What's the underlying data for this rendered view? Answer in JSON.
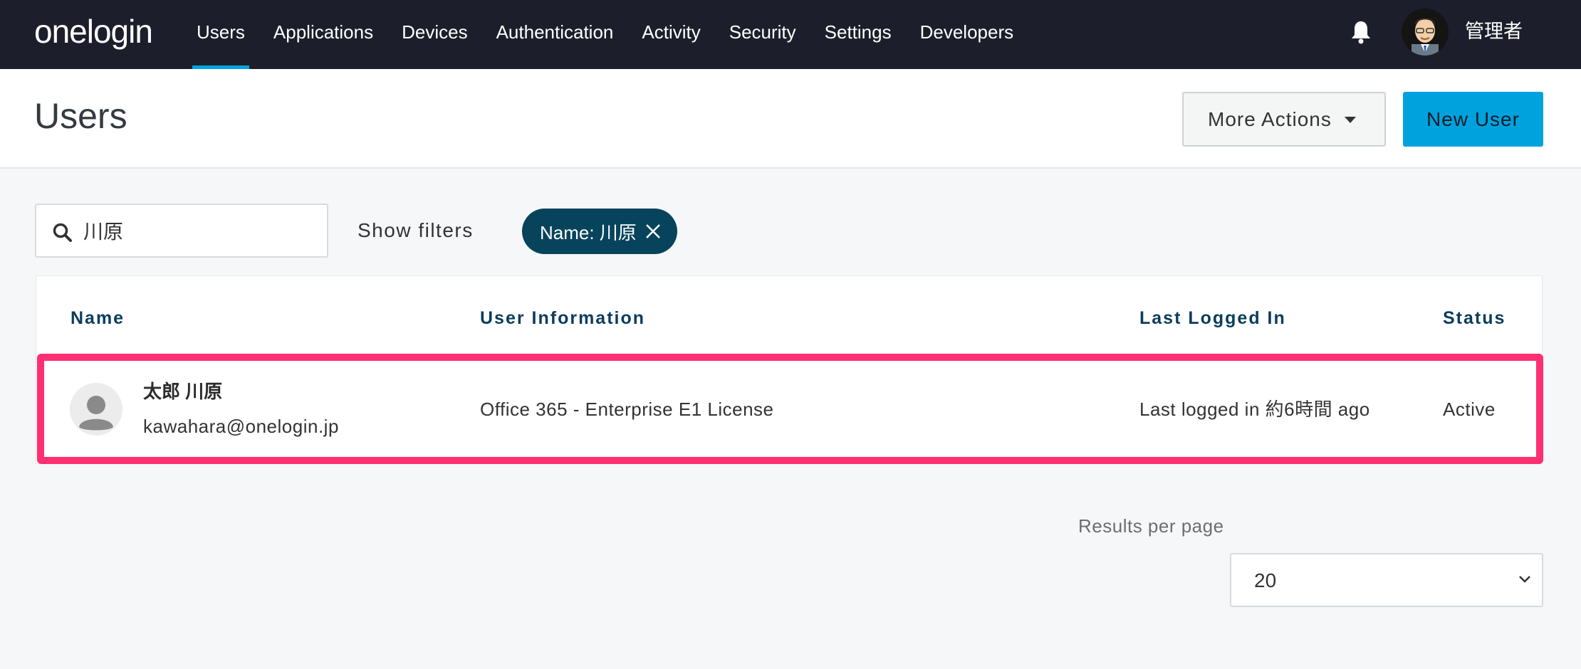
{
  "nav": {
    "logo": "onelogin",
    "items": [
      {
        "label": "Users",
        "active": true
      },
      {
        "label": "Applications",
        "active": false
      },
      {
        "label": "Devices",
        "active": false
      },
      {
        "label": "Authentication",
        "active": false
      },
      {
        "label": "Activity",
        "active": false
      },
      {
        "label": "Security",
        "active": false
      },
      {
        "label": "Settings",
        "active": false
      },
      {
        "label": "Developers",
        "active": false
      }
    ],
    "notification_icon": "bell-icon",
    "user_name": "管理者"
  },
  "header": {
    "title": "Users",
    "more_actions_label": "More Actions",
    "new_user_label": "New User"
  },
  "filters": {
    "search_value": "川原",
    "show_filters_label": "Show filters",
    "active_chip": "Name: 川原"
  },
  "table": {
    "columns": [
      "Name",
      "User Information",
      "Last Logged In",
      "Status"
    ],
    "rows": [
      {
        "name": "太郎 川原",
        "email": "kawahara@onelogin.jp",
        "info": "Office 365 - Enterprise E1 License",
        "last_logged_in": "Last logged in 約6時間 ago",
        "status": "Active"
      }
    ]
  },
  "pagination": {
    "results_per_page_label": "Results per page",
    "results_per_page_value": "20"
  },
  "colors": {
    "nav_bg": "#1c1f2b",
    "accent": "#00a2de",
    "chip_bg": "#07445c",
    "highlight": "#ff2f72"
  }
}
